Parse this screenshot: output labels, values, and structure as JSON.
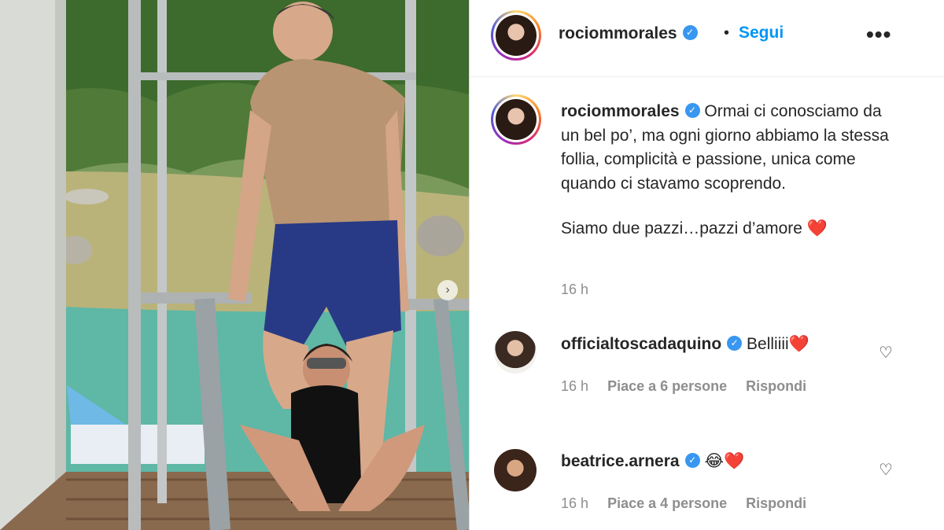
{
  "post": {
    "author": "rociommorales",
    "follow_label": "Segui",
    "dot_separator": "•",
    "more_label": "•••",
    "verified_glyph": "✓",
    "caption_line1": "Ormai ci conosciamo da un bel po’, ma ogni giorno abbiamo la stessa follia, complicità e passione, unica come quando ci stavamo scoprendo.",
    "caption_line2": "Siamo due pazzi…pazzi d’amore",
    "caption_emoji": "❤️",
    "time": "16 h",
    "carousel_next_glyph": "›"
  },
  "comments": [
    {
      "user": "officialtoscadaquino",
      "text": "Belliiii",
      "emoji": "❤️",
      "time": "16 h",
      "likes": "Piace a 6 persone",
      "reply": "Rispondi",
      "heart_glyph": "♡"
    },
    {
      "user": "beatrice.arnera",
      "text": "",
      "emoji": "😂❤️",
      "time": "16 h",
      "likes": "Piace a 4 persone",
      "reply": "Rispondi",
      "heart_glyph": "♡"
    }
  ],
  "colors": {
    "follow": "#0095f6",
    "verified": "#3897f0",
    "muted": "#8e8e8e",
    "heart": "#e0182d"
  },
  "icons": [
    "verified-badge-icon",
    "more-options-icon",
    "heart-outline-icon",
    "carousel-next-icon"
  ]
}
